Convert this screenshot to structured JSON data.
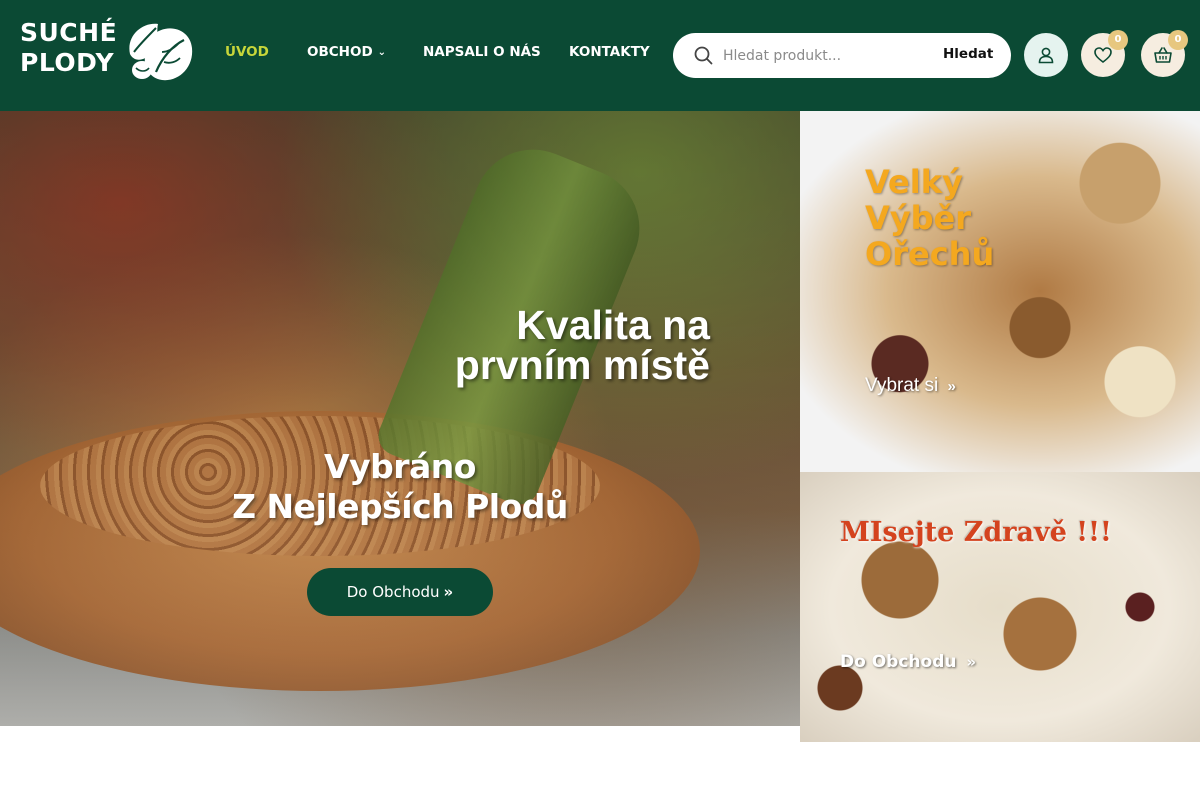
{
  "brand": {
    "line1": "SUCHÉ",
    "line2": "PLODY",
    "logo_icon": "leaf-nut-icon"
  },
  "nav": [
    {
      "label": "ÚVOD",
      "active": true
    },
    {
      "label": "OBCHOD",
      "has_dropdown": true
    },
    {
      "label": "NAPSALI O NÁS"
    },
    {
      "label": "KONTAKTY"
    }
  ],
  "search": {
    "placeholder": "Hledat produkt...",
    "button_label": "Hledat",
    "icon": "search-icon"
  },
  "header_icons": {
    "user": {
      "icon": "user-icon"
    },
    "wishlist": {
      "icon": "heart-icon",
      "count": "0"
    },
    "cart": {
      "icon": "basket-icon",
      "count": "0"
    }
  },
  "hero": {
    "title_line1": "Kvalita na",
    "title_line2": "prvním místě",
    "subtitle_line1": "Vybráno",
    "subtitle_line2": "Z Nejlepších Plodů",
    "button_label": "Do Obchodu",
    "button_icon": "double-chevron-right-icon"
  },
  "promo_nuts": {
    "title_line1": "Velký",
    "title_line2": "Výběr",
    "title_line3": "Ořechů",
    "link_label": "Vybrat si",
    "link_icon": "double-chevron-right-icon"
  },
  "promo_healthy": {
    "title": "MIsejte Zdravě !!!",
    "link_label": "Do Obchodu",
    "link_icon": "double-chevron-right-icon"
  },
  "colors": {
    "header_bg": "#0b4a34",
    "nav_active": "#c7d63a",
    "promo_title": "#f4a81f",
    "promo2_title": "#d4431e",
    "badge": "#e7c77f"
  }
}
